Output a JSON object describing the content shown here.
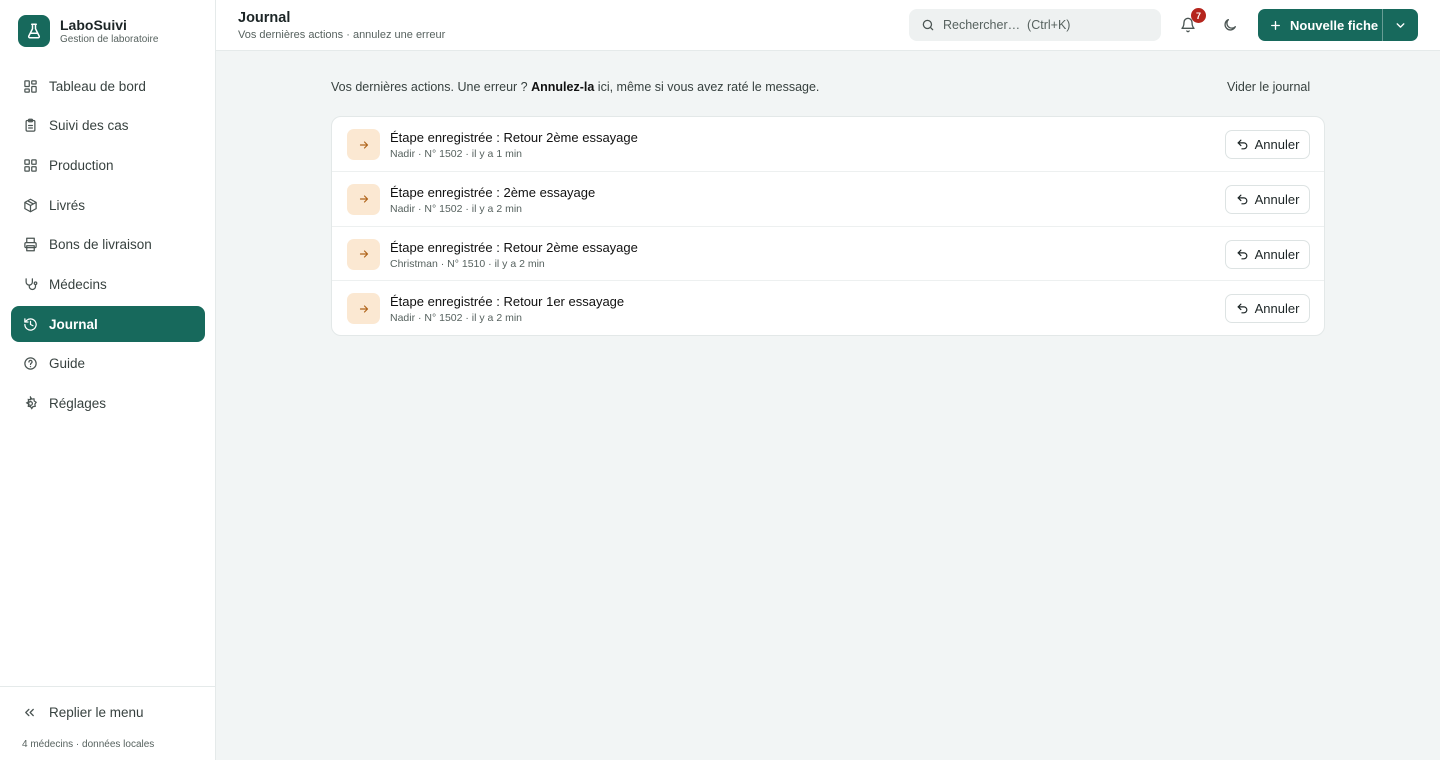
{
  "brand": {
    "name": "LaboSuivi",
    "subtitle": "Gestion de laboratoire"
  },
  "sidebar": {
    "items": [
      {
        "label": "Tableau de bord",
        "icon": "grid-icon"
      },
      {
        "label": "Suivi des cas",
        "icon": "clipboard-icon"
      },
      {
        "label": "Production",
        "icon": "grid-icon"
      },
      {
        "label": "Livrés",
        "icon": "package-icon"
      },
      {
        "label": "Bons de livraison",
        "icon": "printer-icon"
      },
      {
        "label": "Médecins",
        "icon": "stethoscope-icon"
      },
      {
        "label": "Journal",
        "icon": "history-icon",
        "active": true
      },
      {
        "label": "Guide",
        "icon": "help-circle-icon"
      },
      {
        "label": "Réglages",
        "icon": "gear-icon"
      }
    ],
    "collapse_label": "Replier le menu",
    "footer_note": "4 médecins · données locales"
  },
  "header": {
    "title": "Journal",
    "subtitle": "Vos dernières actions · annulez une erreur",
    "search_placeholder": "Rechercher…  (Ctrl+K)",
    "notification_count": "7",
    "new_button_label": "Nouvelle fiche"
  },
  "main": {
    "intro_before": "Vos dernières actions. Une erreur ? ",
    "intro_bold": "Annulez-la",
    "intro_after": " ici, même si vous avez raté le message.",
    "clear_label": "Vider le journal",
    "undo_label": "Annuler",
    "entries": [
      {
        "title": "Étape enregistrée : Retour 2ème essayage",
        "meta": "Nadir · N° 1502 · il y a 1 min"
      },
      {
        "title": "Étape enregistrée : 2ème essayage",
        "meta": "Nadir · N° 1502 · il y a 2 min"
      },
      {
        "title": "Étape enregistrée : Retour 2ème essayage",
        "meta": "Christman · N° 1510 · il y a 2 min"
      },
      {
        "title": "Étape enregistrée : Retour 1er essayage",
        "meta": "Nadir · N° 1502 · il y a 2 min"
      }
    ]
  },
  "colors": {
    "accent": "#17695c",
    "badge": "#b5251d",
    "entry_icon_bg": "#fbe8d2",
    "entry_icon_fg": "#b0651c"
  }
}
